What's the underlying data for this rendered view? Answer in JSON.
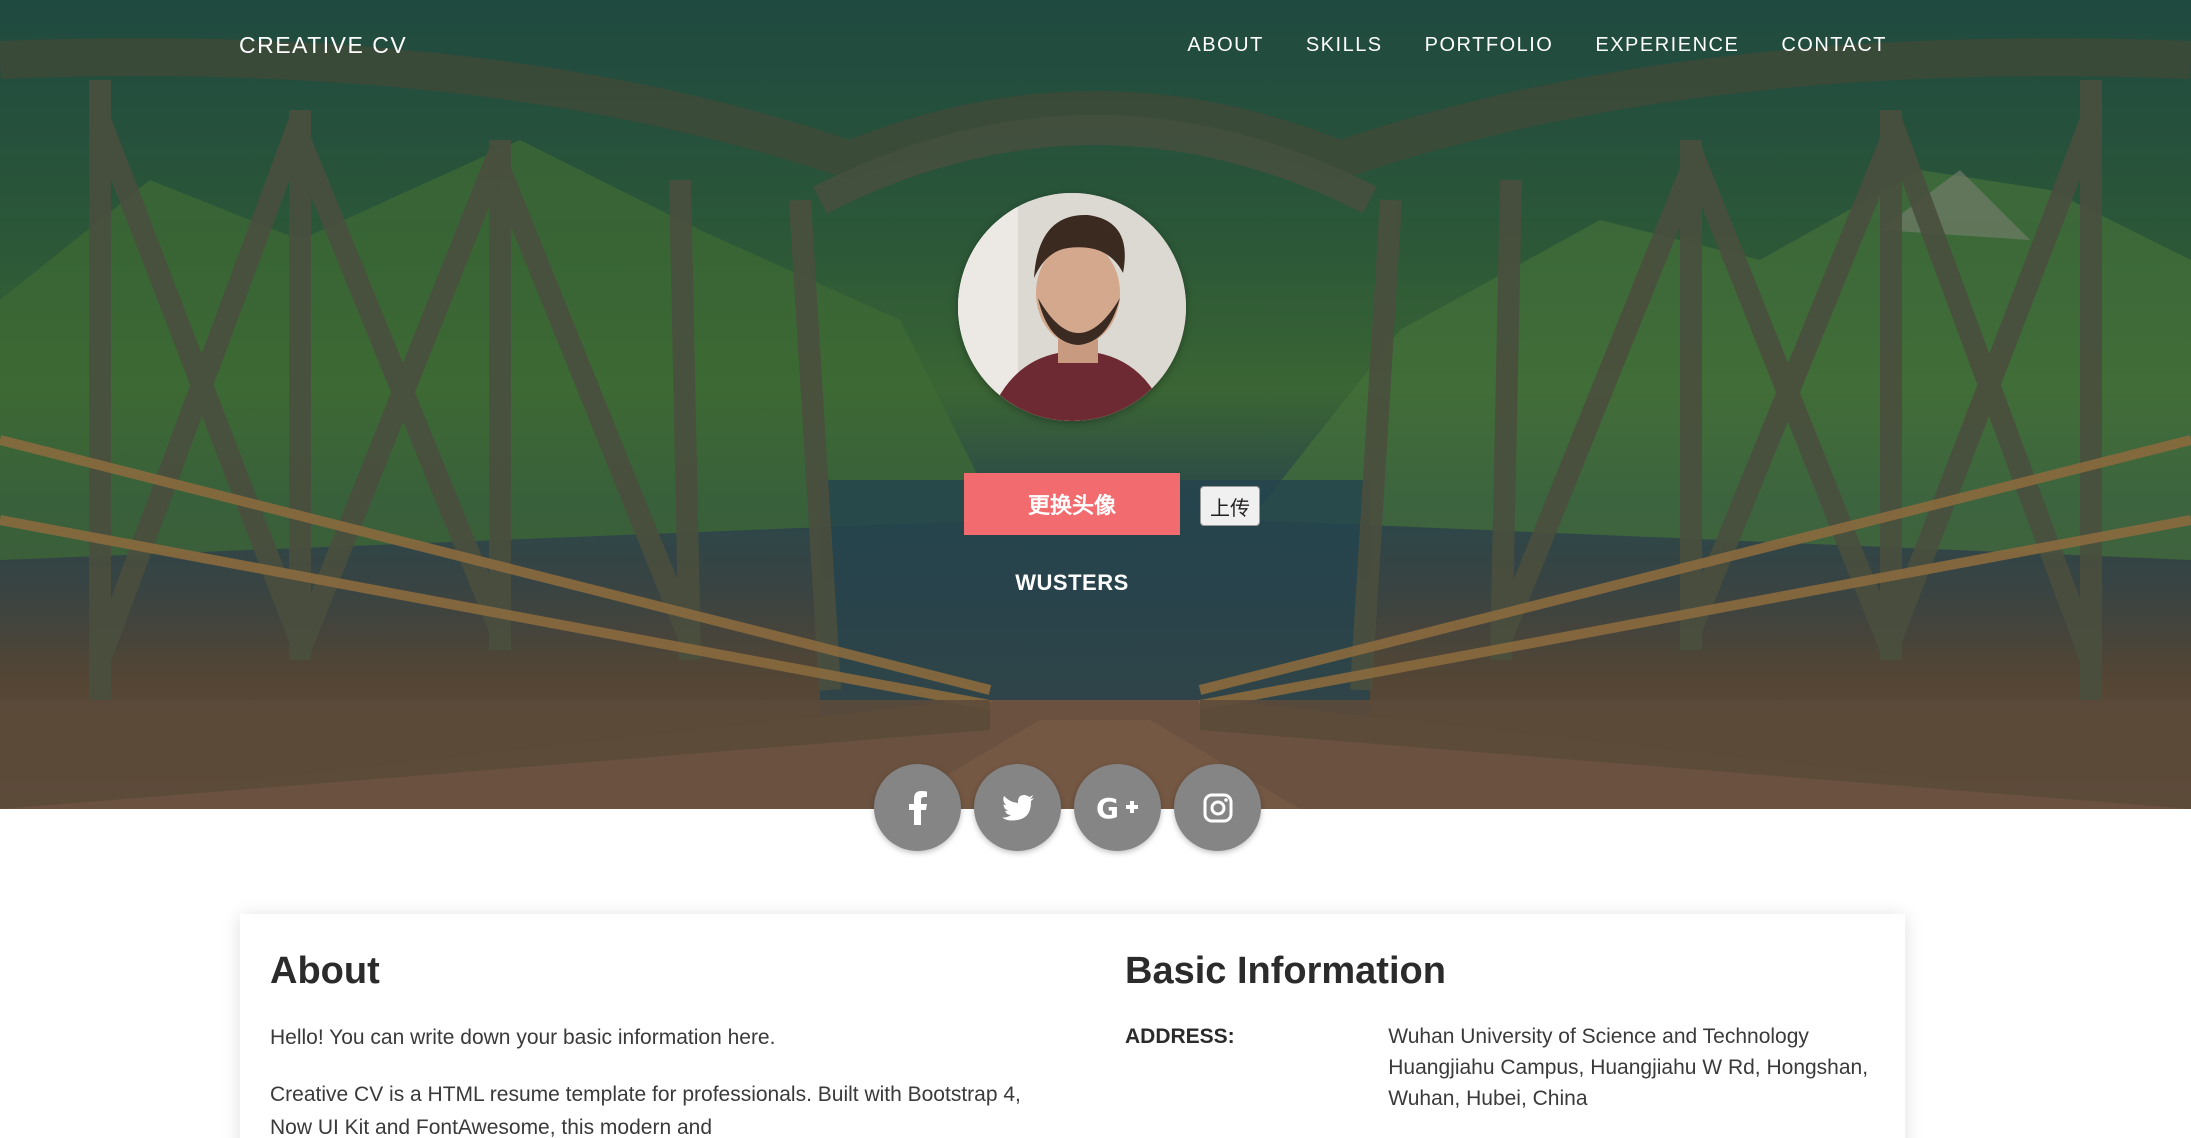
{
  "nav": {
    "brand": "CREATIVE CV",
    "links": [
      "ABOUT",
      "SKILLS",
      "PORTFOLIO",
      "EXPERIENCE",
      "CONTACT"
    ]
  },
  "profile": {
    "change_avatar_label": "更换头像",
    "upload_label": "上传",
    "name": "WUSTERS"
  },
  "social": [
    "facebook-icon",
    "twitter-icon",
    "google-plus-icon",
    "instagram-icon"
  ],
  "about": {
    "title": "About",
    "p1": "Hello! You can write down your basic information here.",
    "p2": "Creative CV is a HTML resume template for professionals. Built with Bootstrap 4, Now UI Kit and FontAwesome, this modern and"
  },
  "basic_info": {
    "title": "Basic Information",
    "rows": [
      {
        "key": "ADDRESS:",
        "value": "Wuhan University of Science and Technology Huangjiahu Campus, Huangjiahu W Rd, Hongshan, Wuhan, Hubei, China"
      }
    ]
  },
  "colors": {
    "accent": "#f26b6f",
    "social_button": "#858585"
  }
}
